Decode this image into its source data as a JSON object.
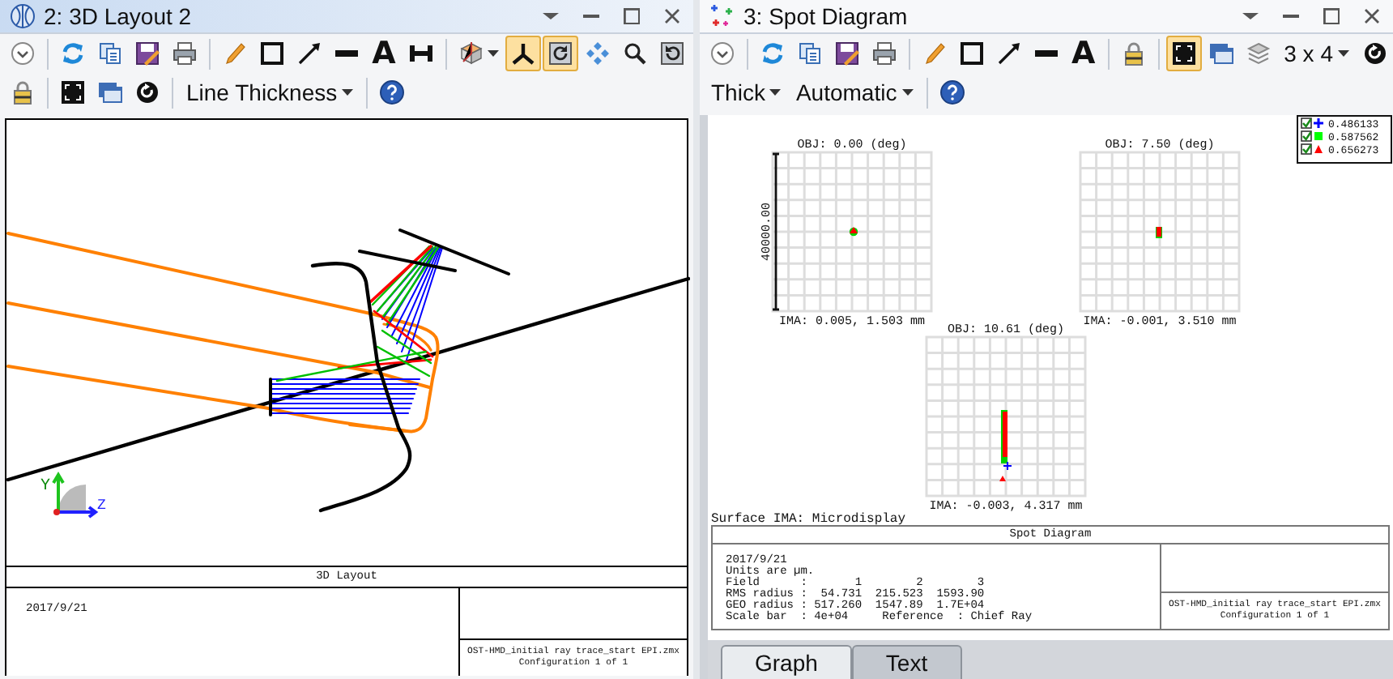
{
  "layout_window": {
    "title": "2: 3D Layout 2",
    "active": true,
    "toolbar": [
      [
        {
          "kind": "tool",
          "selected": false
        },
        {
          "kind": "separator"
        },
        {
          "kind": "tool",
          "selected": false
        },
        {
          "kind": "tool",
          "selected": false
        },
        {
          "kind": "tool",
          "selected": false
        },
        {
          "kind": "tool",
          "selected": false
        },
        {
          "kind": "separator"
        },
        {
          "kind": "tool",
          "selected": false
        },
        {
          "kind": "tool",
          "selected": false
        },
        {
          "kind": "tool",
          "selected": false
        },
        {
          "kind": "tool",
          "selected": false
        },
        {
          "kind": "tool",
          "label": "A",
          "selected": false
        },
        {
          "kind": "tool",
          "selected": false
        },
        {
          "kind": "separator"
        },
        {
          "kind": "tool-menu",
          "selected": false
        },
        {
          "kind": "tool",
          "selected": true
        },
        {
          "kind": "tool",
          "selected": true
        },
        {
          "kind": "tool",
          "selected": false
        },
        {
          "kind": "tool",
          "selected": false
        },
        {
          "kind": "tool",
          "selected": false
        }
      ],
      [
        {
          "kind": "tool",
          "selected": false
        },
        {
          "kind": "separator"
        },
        {
          "kind": "tool",
          "selected": false
        },
        {
          "kind": "tool",
          "selected": false
        },
        {
          "kind": "tool",
          "selected": false
        },
        {
          "kind": "separator"
        },
        {
          "kind": "dropdown",
          "label": "Line Thickness"
        },
        {
          "kind": "separator"
        },
        {
          "kind": "tool",
          "selected": false
        }
      ]
    ],
    "axis_labels": [
      "Y",
      "Z"
    ],
    "info_box": {
      "title": "3D Layout",
      "date": "2017/9/21",
      "file_lines": [
        "OST-HMD_initial ray trace_start EPI.zmx",
        "Configuration 1 of 1"
      ]
    }
  },
  "spot_window": {
    "title": "3: Spot Diagram",
    "active": false,
    "toolbar": [
      [
        {
          "kind": "tool",
          "selected": false
        },
        {
          "kind": "separator"
        },
        {
          "kind": "tool",
          "selected": false
        },
        {
          "kind": "tool",
          "selected": false
        },
        {
          "kind": "tool",
          "selected": false
        },
        {
          "kind": "tool",
          "selected": false
        },
        {
          "kind": "separator"
        },
        {
          "kind": "tool",
          "selected": false
        },
        {
          "kind": "tool",
          "selected": false
        },
        {
          "kind": "tool",
          "selected": false
        },
        {
          "kind": "tool",
          "selected": false
        },
        {
          "kind": "tool",
          "label": "A",
          "selected": false
        },
        {
          "kind": "separator"
        },
        {
          "kind": "tool",
          "selected": false
        },
        {
          "kind": "separator"
        },
        {
          "kind": "tool",
          "selected": true
        },
        {
          "kind": "tool",
          "selected": false
        },
        {
          "kind": "tool",
          "selected": false
        },
        {
          "kind": "dropdown",
          "label": "3 x 4"
        },
        {
          "kind": "tool",
          "selected": false
        }
      ],
      [
        {
          "kind": "dropdown",
          "label": "Thick"
        },
        {
          "kind": "dropdown",
          "label": "Automatic"
        },
        {
          "kind": "separator"
        },
        {
          "kind": "tool",
          "selected": false
        }
      ]
    ],
    "legend": [
      {
        "label": "0.486133",
        "color": "#0000ff",
        "kind": "plus",
        "checked": true
      },
      {
        "label": "0.587562",
        "color": "#00ff00",
        "kind": "square",
        "checked": true
      },
      {
        "label": "0.656273",
        "color": "#ff0000",
        "kind": "triangle",
        "checked": true
      }
    ],
    "scale_bar": "40000.00",
    "fields": [
      {
        "obj": "OBJ: 0.00 (deg)",
        "ima": "IMA: 0.005, 1.503 mm"
      },
      {
        "obj": "OBJ: 7.50 (deg)",
        "ima": "IMA: -0.001, 3.510 mm"
      },
      {
        "obj": "OBJ: 10.61 (deg)",
        "ima": "IMA: -0.003, 4.317 mm"
      }
    ],
    "surface": "Surface IMA: Microdisplay",
    "info_box": {
      "title": "Spot Diagram",
      "lines": [
        "2017/9/21",
        "Units are µm.",
        "Field      :       1        2        3",
        "RMS radius :  54.731  215.523  1593.90",
        "GEO radius : 517.260  1547.89  1.7E+04",
        "Scale bar  : 4e+04     Reference  : Chief Ray"
      ],
      "file_lines": [
        "OST-HMD_initial ray trace_start EPI.zmx",
        "Configuration 1 of 1"
      ]
    },
    "tabs": [
      {
        "label": "Graph",
        "selected": true
      },
      {
        "label": "Text",
        "selected": false
      }
    ]
  }
}
